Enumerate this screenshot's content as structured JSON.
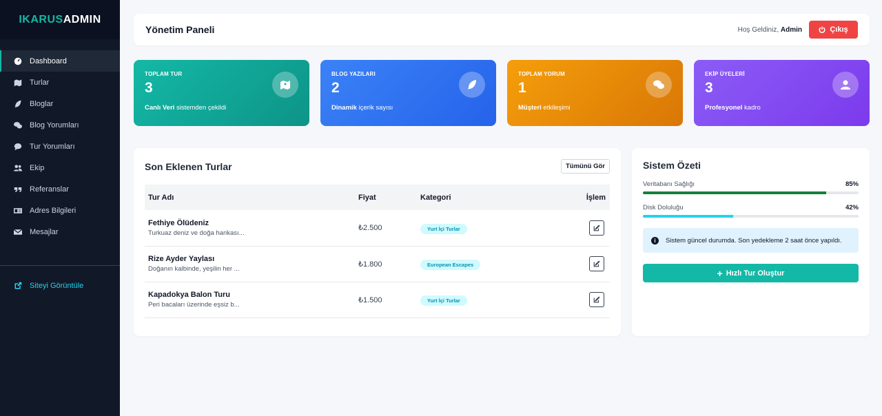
{
  "brand": {
    "part1": "IKARUS",
    "part2": "ADMIN"
  },
  "sidebar": {
    "items": [
      {
        "label": "Dashboard",
        "icon": "dashboard-icon",
        "active": true
      },
      {
        "label": "Turlar",
        "icon": "map-icon"
      },
      {
        "label": "Bloglar",
        "icon": "feather-icon"
      },
      {
        "label": "Blog Yorumları",
        "icon": "comments-icon"
      },
      {
        "label": "Tur Yorumları",
        "icon": "comment-icon"
      },
      {
        "label": "Ekip",
        "icon": "users-icon"
      },
      {
        "label": "Referanslar",
        "icon": "quote-icon"
      },
      {
        "label": "Adres Bilgileri",
        "icon": "address-card-icon"
      },
      {
        "label": "Mesajlar",
        "icon": "envelope-icon"
      }
    ],
    "site_link": "Siteyi Görüntüle"
  },
  "header": {
    "title": "Yönetim Paneli",
    "welcome_prefix": "Hoş Geldiniz,",
    "user": "Admin",
    "logout_label": "Çıkış"
  },
  "stats": [
    {
      "label": "TOPLAM TUR",
      "value": "3",
      "desc_bold": "Canlı Veri",
      "desc_rest": " sistemden çekildi",
      "icon": "map-icon"
    },
    {
      "label": "BLOG YAZILARI",
      "value": "2",
      "desc_bold": "Dinamik",
      "desc_rest": " içerik sayısı",
      "icon": "feather-icon"
    },
    {
      "label": "TOPLAM YORUM",
      "value": "1",
      "desc_bold": "Müşteri",
      "desc_rest": " etkileşimi",
      "icon": "comments-icon"
    },
    {
      "label": "EKİP ÜYELERİ",
      "value": "3",
      "desc_bold": "Profesyonel",
      "desc_rest": " kadro",
      "icon": "user-icon"
    }
  ],
  "tours": {
    "title": "Son Eklenen Turlar",
    "view_all": "Tümünü Gör",
    "columns": [
      "Tur Adı",
      "Fiyat",
      "Kategori",
      "İşlem"
    ],
    "rows": [
      {
        "name": "Fethiye Ölüdeniz",
        "desc": "Turkuaz deniz ve doğa harikası...",
        "price": "₺2.500",
        "category": "Yurt İçi Turlar"
      },
      {
        "name": "Rize Ayder Yaylası",
        "desc": "Doğanın kalbinde, yeşilin her ...",
        "price": "₺1.800",
        "category": "European Escapes"
      },
      {
        "name": "Kapadokya Balon Turu",
        "desc": "Peri bacaları üzerinde eşsiz b...",
        "price": "₺1.500",
        "category": "Yurt İçi Turlar"
      }
    ]
  },
  "system": {
    "title": "Sistem Özeti",
    "metrics": [
      {
        "label": "Veritabanı Sağlığı",
        "value": "85%",
        "percent": 85,
        "color": "#15803d"
      },
      {
        "label": "Disk Doluluğu",
        "value": "42%",
        "percent": 42,
        "color": "#22d3ee"
      }
    ],
    "info": "Sistem güncel durumda. Son yedekleme 2 saat önce yapıldı.",
    "quick_label": "Hızlı Tur Oluştur"
  }
}
